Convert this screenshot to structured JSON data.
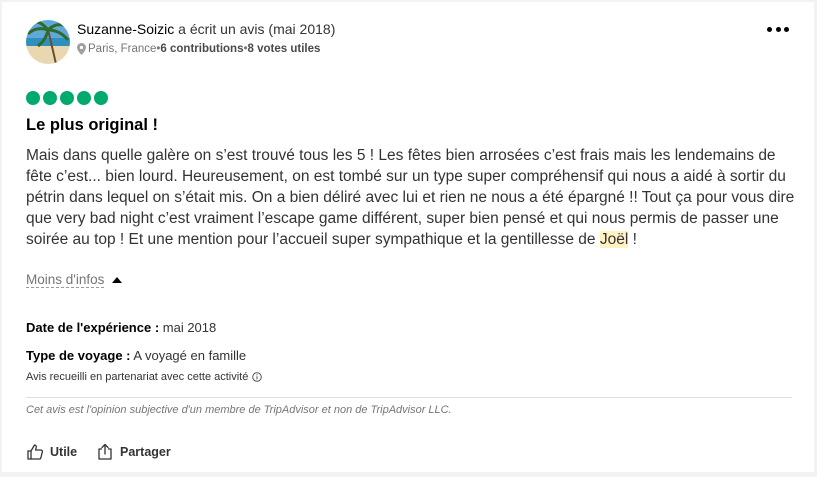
{
  "review": {
    "author_name": "Suzanne-Soizic",
    "author_action": " a écrit un avis (mai 2018)",
    "location": "Paris, France",
    "separator": " • ",
    "contributions": "6 contributions",
    "helpful_votes": "8 votes utiles",
    "rating_bubbles": 5,
    "rating_color": "#00aa6c",
    "title": "Le plus original !",
    "body_main": "Mais dans quelle galère on s’est trouvé tous les 5 ! Les fêtes bien arrosées c’est frais mais les lendemains de fête c’est... bien lourd. Heureusement, on est tombé sur un type super compréhensif qui nous a aidé à sortir du pétrin dans lequel on s’était mis. On a bien déliré avec lui et rien ne nous a été épargné !! Tout ça pour vous dire que very bad night c’est vraiment l’escape game différent, super bien pensé et qui nous permis de passer une soirée au top ! Et une mention pour l’accueil super sympathique et la gentillesse de ",
    "body_highlight": "Joël",
    "body_end": " !",
    "less_info": "Moins d'infos",
    "experience_label": "Date de l'expérience :",
    "experience_value": " mai 2018",
    "trip_type_label": "Type de voyage :",
    "trip_type_value": " A voyagé en famille",
    "collected_note": "Avis recueilli en partenariat avec cette activité",
    "disclaimer": "Cet avis est l'opinion subjective d'un membre de TripAdvisor et non de TripAdvisor LLC.",
    "helpful_button": "Utile",
    "share_button": "Partager"
  },
  "icons": {
    "more": "more-horizontal-icon",
    "location": "map-pin-icon",
    "info": "info-icon",
    "helpful": "thumbs-up-icon",
    "share": "share-icon"
  }
}
